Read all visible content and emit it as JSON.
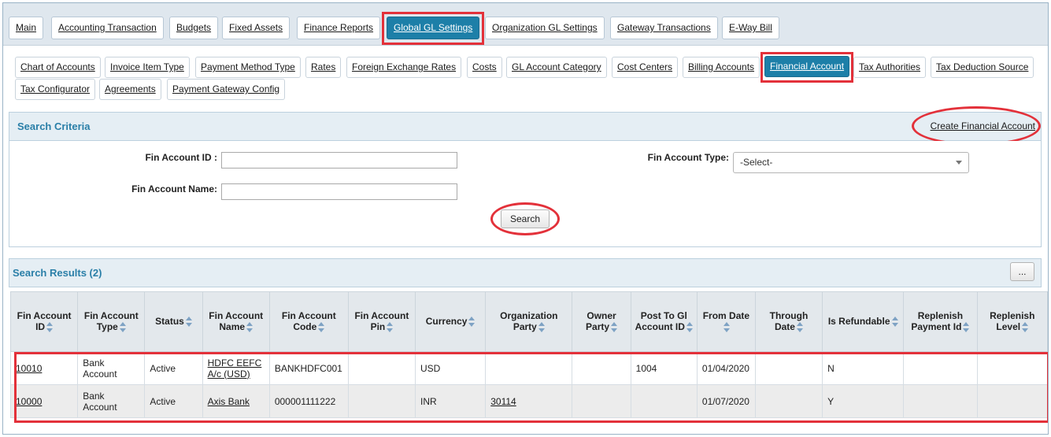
{
  "main_tabs": [
    {
      "label": "Main"
    },
    {
      "label": "Accounting Transaction"
    },
    {
      "label": "Budgets"
    },
    {
      "label": "Fixed Assets"
    },
    {
      "label": "Finance Reports"
    },
    {
      "label": "Global GL Settings",
      "active": true
    },
    {
      "label": "Organization GL Settings"
    },
    {
      "label": "Gateway Transactions"
    },
    {
      "label": "E-Way Bill"
    }
  ],
  "sub_tabs": [
    {
      "label": "Chart of Accounts"
    },
    {
      "label": "Invoice Item Type"
    },
    {
      "label": "Payment Method Type"
    },
    {
      "label": "Rates"
    },
    {
      "label": "Foreign Exchange Rates"
    },
    {
      "label": "Costs"
    },
    {
      "label": "GL Account Category"
    },
    {
      "label": "Cost Centers"
    },
    {
      "label": "Billing Accounts"
    },
    {
      "label": "Financial Account",
      "active": true
    },
    {
      "label": "Tax Authorities"
    },
    {
      "label": "Tax Deduction Source"
    },
    {
      "label": "Tax Configurator"
    },
    {
      "label": "Agreements"
    },
    {
      "label": "Payment Gateway Config"
    }
  ],
  "search_criteria": {
    "title": "Search Criteria",
    "create_link": "Create Financial Account",
    "fin_account_id_label": "Fin Account ID :",
    "fin_account_id_value": "",
    "fin_account_name_label": "Fin Account Name:",
    "fin_account_name_value": "",
    "fin_account_type_label": "Fin Account Type:",
    "fin_account_type_selected": "-Select-",
    "search_button": "Search"
  },
  "results": {
    "title": "Search Results (2)",
    "more_button": "...",
    "columns": [
      "Fin Account ID",
      "Fin Account Type",
      "Status",
      "Fin Account Name",
      "Fin Account Code",
      "Fin Account Pin",
      "Currency",
      "Organization Party",
      "Owner Party",
      "Post To Gl Account ID",
      "From Date",
      "Through Date",
      "Is Refundable",
      "Replenish Payment Id",
      "Replenish Level"
    ],
    "rows": [
      [
        "10010",
        "Bank Account",
        "Active",
        "HDFC EEFC A/c (USD)",
        "BANKHDFC001",
        "",
        "USD",
        "",
        "",
        "1004",
        "01/04/2020",
        "",
        "N",
        "",
        ""
      ],
      [
        "10000",
        "Bank Account",
        "Active",
        "Axis Bank",
        "000001111222",
        "",
        "INR",
        "30114",
        "",
        "",
        "01/07/2020",
        "",
        "Y",
        "",
        ""
      ]
    ]
  },
  "colors": {
    "accent": "#1d7fa8",
    "highlight": "#e3313a",
    "panel_title": "#2a7fa8"
  }
}
